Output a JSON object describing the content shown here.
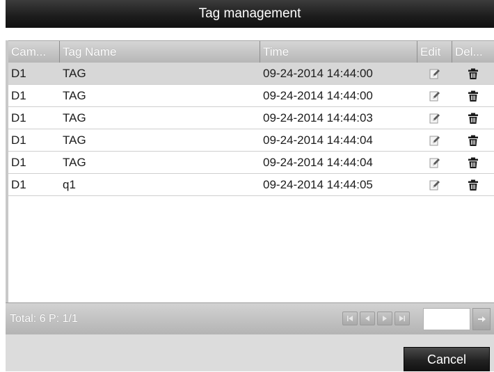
{
  "dialog": {
    "title": "Tag management"
  },
  "table": {
    "columns": [
      {
        "key": "cam",
        "label": "Cam..."
      },
      {
        "key": "name",
        "label": "Tag Name"
      },
      {
        "key": "time",
        "label": "Time"
      },
      {
        "key": "edit",
        "label": "Edit"
      },
      {
        "key": "del",
        "label": "Del..."
      }
    ],
    "rows": [
      {
        "cam": "D1",
        "name": "TAG",
        "time": "09-24-2014 14:44:00",
        "selected": true
      },
      {
        "cam": "D1",
        "name": "TAG",
        "time": "09-24-2014 14:44:00",
        "selected": false
      },
      {
        "cam": "D1",
        "name": "TAG",
        "time": "09-24-2014 14:44:03",
        "selected": false
      },
      {
        "cam": "D1",
        "name": "TAG",
        "time": "09-24-2014 14:44:04",
        "selected": false
      },
      {
        "cam": "D1",
        "name": "TAG",
        "time": "09-24-2014 14:44:04",
        "selected": false
      },
      {
        "cam": "D1",
        "name": "q1",
        "time": "09-24-2014 14:44:05",
        "selected": false
      }
    ],
    "edit_icon": "edit-icon",
    "delete_icon": "trash-icon"
  },
  "footer": {
    "total_label": "Total: 6 P: 1/1",
    "pager_icons": [
      "first-page-icon",
      "prev-page-icon",
      "next-page-icon",
      "last-page-icon"
    ],
    "page_input_value": "",
    "go_icon": "go-arrow-icon"
  },
  "buttons": {
    "cancel_label": "Cancel"
  },
  "colors": {
    "titlebar": "#1c1c1c",
    "header": "#c4c4c4",
    "selected_row": "#d7d7d7"
  }
}
